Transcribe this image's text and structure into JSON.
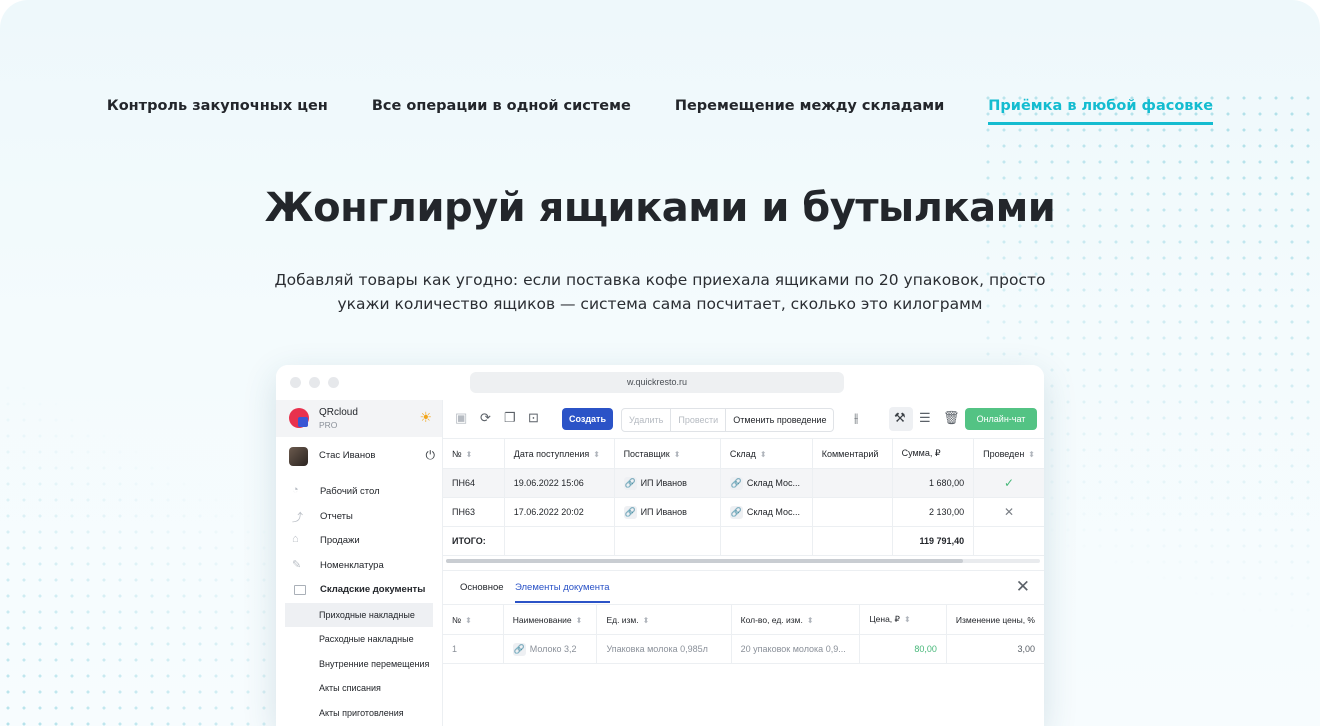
{
  "tabs": [
    {
      "label": "Контроль закупочных цен",
      "active": false
    },
    {
      "label": "Все операции в одной системе",
      "active": false
    },
    {
      "label": "Перемещение между складами",
      "active": false
    },
    {
      "label": "Приёмка в любой фасовке",
      "active": true
    }
  ],
  "hero": {
    "title": "Жонглируй ящиками и бутылками",
    "lead_line1": "Добавляй товары как угодно: если поставка кофе приехала ящиками по 20 упаковок, просто",
    "lead_line2": "укажи количество ящиков — система сама посчитает, сколько это килограмм"
  },
  "colors": {
    "accent": "#14bcd0",
    "primary": "#2b53c7",
    "chat": "#53c384"
  },
  "browser": {
    "url": "w.quickresto.ru"
  },
  "app": {
    "brand": {
      "name": "QRcloud",
      "plan": "PRO"
    },
    "user": {
      "name": "Стас Иванов"
    },
    "menu": [
      {
        "label": "Рабочий стол",
        "icon": "dashboard-icon"
      },
      {
        "label": "Отчеты",
        "icon": "chart-icon"
      },
      {
        "label": "Продажи",
        "icon": "basket-icon"
      },
      {
        "label": "Номенклатура",
        "icon": "pencil-icon"
      },
      {
        "label": "Складские документы",
        "icon": "box-icon"
      }
    ],
    "submenu": [
      {
        "label": "Приходные накладные",
        "selected": true
      },
      {
        "label": "Расходные накладные",
        "selected": false
      },
      {
        "label": "Внутренние перемещения",
        "selected": false
      },
      {
        "label": "Акты списания",
        "selected": false
      },
      {
        "label": "Акты приготовления",
        "selected": false
      }
    ],
    "toolbar": {
      "create": "Создать",
      "delete": "Удалить",
      "post": "Провести",
      "unpost": "Отменить проведение",
      "chat": "Онлайн-чат"
    },
    "docs": {
      "columns": [
        "№",
        "Дата поступления",
        "Поставщик",
        "Склад",
        "Комментарий",
        "Сумма, ₽",
        "Проведен"
      ],
      "rows": [
        {
          "num": "ПН64",
          "date": "19.06.2022 15:06",
          "supplier": "ИП Иванов",
          "warehouse": "Склад Мос...",
          "comment": "",
          "sum": "1 680,00",
          "posted": "✓"
        },
        {
          "num": "ПН63",
          "date": "17.06.2022 20:02",
          "supplier": "ИП Иванов",
          "warehouse": "Склад Мос...",
          "comment": "",
          "sum": "2 130,00",
          "posted": "✕"
        }
      ],
      "total_label": "ИТОГО:",
      "total_sum": "119 791,40"
    },
    "panel": {
      "tabs": [
        "Основное",
        "Элементы документа"
      ],
      "columns": [
        "№",
        "Наименование",
        "Ед. изм.",
        "Кол-во, ед. изм.",
        "Цена, ₽",
        "Изменение цены, %"
      ],
      "row": {
        "num": "1",
        "name": "Молоко 3,2",
        "unit": "Упаковка молока 0,985л",
        "qty": "20 упаковок молока 0,9...",
        "price": "80,00",
        "change": "3,00"
      }
    }
  }
}
